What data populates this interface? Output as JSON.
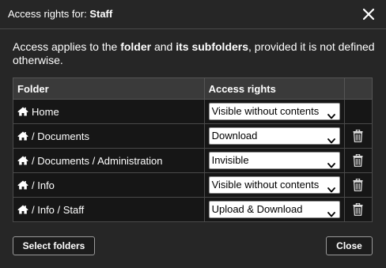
{
  "header": {
    "title_prefix": "Access rights for: ",
    "title_subject": "Staff"
  },
  "intro": {
    "part1": "Access applies to the ",
    "bold1": "folder",
    "part2": " and ",
    "bold2": "its subfolders",
    "part3": ", provided it is not defined otherwise."
  },
  "table": {
    "headers": {
      "folder": "Folder",
      "rights": "Access rights",
      "action": ""
    },
    "rows": [
      {
        "folder": "Home",
        "rights": "Visible without contents",
        "deletable": false
      },
      {
        "folder": "/ Documents",
        "rights": "Download",
        "deletable": true
      },
      {
        "folder": "/ Documents / Administration",
        "rights": "Invisible",
        "deletable": true
      },
      {
        "folder": "/ Info",
        "rights": "Visible without contents",
        "deletable": true
      },
      {
        "folder": "/ Info / Staff",
        "rights": "Upload & Download",
        "deletable": true
      }
    ]
  },
  "footer": {
    "select_folders_label": "Select folders",
    "close_label": "Close"
  },
  "icons": {
    "folder_root": "home-icon",
    "delete": "trash-icon",
    "dropdown": "chevron-down-icon",
    "dismiss": "close-icon"
  },
  "colors": {
    "background": "#262626",
    "table_header": "#3a3a3a",
    "table_cell": "#161616",
    "text": "#ffffff"
  }
}
